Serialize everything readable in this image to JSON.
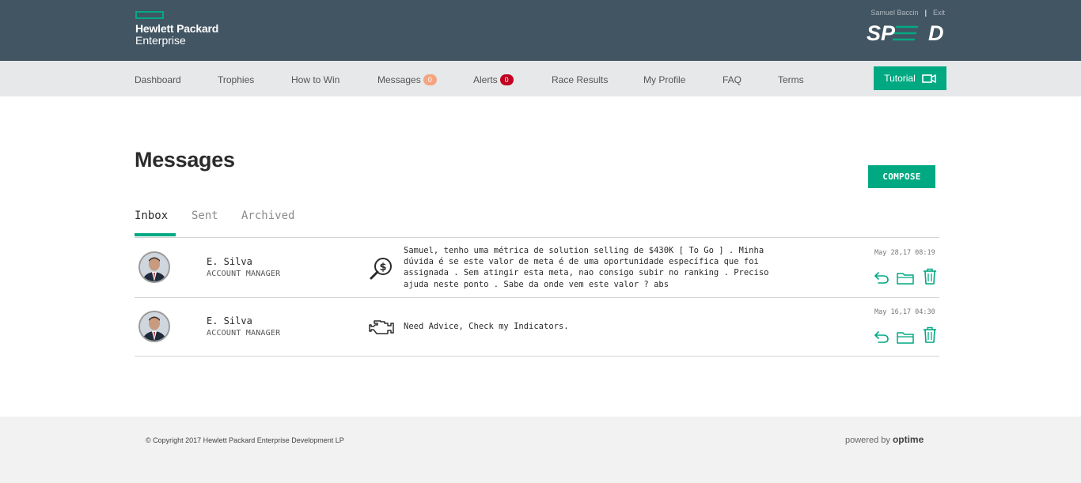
{
  "header": {
    "brand_line1": "Hewlett Packard",
    "brand_line2": "Enterprise",
    "user_name": "Samuel Baccin",
    "separator": "|",
    "exit_label": "Exit",
    "app_logo": "SPEED"
  },
  "nav": {
    "items": [
      {
        "label": "Dashboard"
      },
      {
        "label": "Trophies"
      },
      {
        "label": "How to Win"
      },
      {
        "label": "Messages",
        "badge": "0"
      },
      {
        "label": "Alerts",
        "badge": "0"
      },
      {
        "label": "Race Results"
      },
      {
        "label": "My Profile"
      },
      {
        "label": "FAQ"
      },
      {
        "label": "Terms"
      }
    ],
    "tutorial_label": "Tutorial"
  },
  "page": {
    "title": "Messages",
    "compose_label": "COMPOSE",
    "tabs": [
      {
        "label": "Inbox",
        "active": true
      },
      {
        "label": "Sent",
        "active": false
      },
      {
        "label": "Archived",
        "active": false
      }
    ]
  },
  "messages": [
    {
      "sender": "E. Silva",
      "role": "ACCOUNT MANAGER",
      "icon": "money-search-icon",
      "lines": [
        "Samuel, tenho uma métrica de solution selling de $430K [ To Go ] . Minha",
        "dúvida é se este valor de meta é de uma oportunidade específica que foi",
        "assignada . Sem atingir esta meta, nao consigo subir no ranking . Preciso",
        "ajuda neste ponto . Sabe da onde vem este valor ? abs"
      ],
      "date": "May 28,17 08:19"
    },
    {
      "sender": "E. Silva",
      "role": "ACCOUNT MANAGER",
      "icon": "engine-icon",
      "lines": [
        "Need Advice, Check my Indicators."
      ],
      "date": "May 16,17 04:30"
    }
  ],
  "footer": {
    "copyright": "© Copyright 2017 Hewlett Packard Enterprise Development LP",
    "powered_prefix": "powered by",
    "powered_brand": "optime"
  },
  "colors": {
    "header_bg": "#425563",
    "accent": "#01a982",
    "nav_bg": "#e6e8e9",
    "alert_badge": "#c2001f",
    "message_badge": "#f4a47f"
  }
}
